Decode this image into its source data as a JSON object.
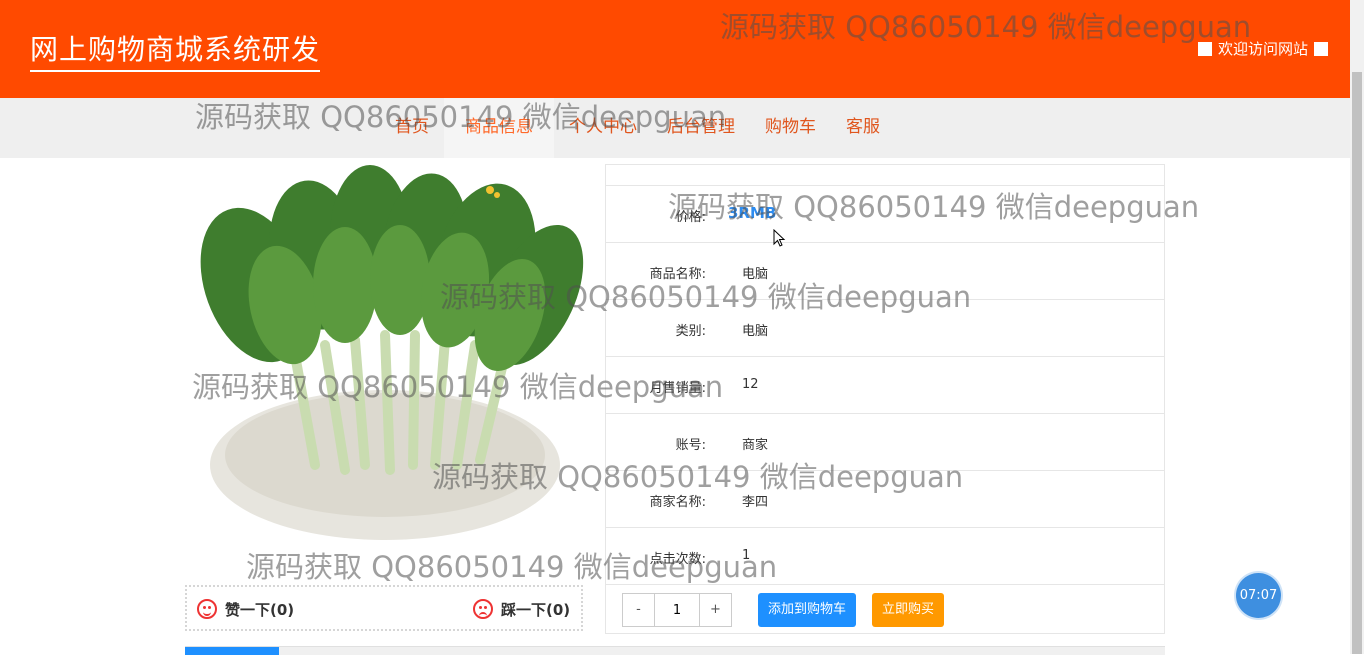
{
  "header": {
    "title": "网上购物商城系统研发",
    "welcome": "欢迎访问网站"
  },
  "nav": {
    "items": [
      "首页",
      "商品信息",
      "个人中心",
      "后台管理",
      "购物车",
      "客服"
    ],
    "active_index": 1
  },
  "product": {
    "image_alt": "青菜",
    "price_label": "价格:",
    "price": "3RMB",
    "fields": [
      {
        "label": "商品名称:",
        "value": "电脑"
      },
      {
        "label": "类别:",
        "value": "电脑"
      },
      {
        "label": "月售销量:",
        "value": "12"
      },
      {
        "label": "账号:",
        "value": "商家"
      },
      {
        "label": "商家名称:",
        "value": "李四"
      },
      {
        "label": "点击次数:",
        "value": "1"
      }
    ]
  },
  "votes": {
    "like_label": "赞一下(0)",
    "dislike_label": "踩一下(0)"
  },
  "purchase": {
    "minus": "-",
    "quantity": "1",
    "plus": "+",
    "add_to_cart": "添加到购物车",
    "buy_now": "立即购买"
  },
  "clock": "07:07",
  "watermarks": [
    "源码获取 QQ86050149 微信deepguan",
    "源码获取 QQ86050149 微信deepguan",
    "源码获取 QQ86050149 微信deepguan",
    "源码获取 QQ86050149 微信deepguan",
    "源码获取 QQ86050149 微信deepguan",
    "源码获取 QQ86050149 微信deepguan",
    "源码获取 QQ86050149 微信deepguan"
  ],
  "colors": {
    "header_bg": "#ff4a00",
    "nav_text": "#e0561e",
    "price": "#2d8cf0",
    "cart_button": "#1e90ff",
    "buy_button": "#ff9900"
  }
}
